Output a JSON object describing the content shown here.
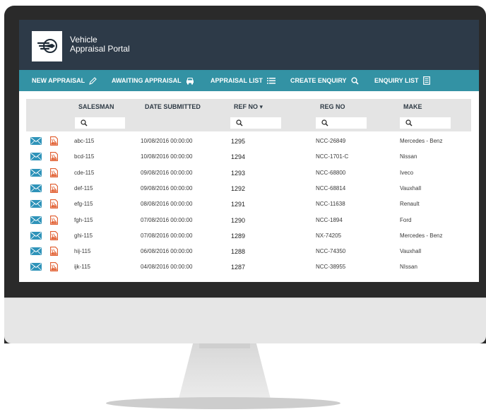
{
  "app": {
    "title_line1": "Vehicle",
    "title_line2": "Appraisal Portal"
  },
  "nav": [
    {
      "label": "NEW APPRAISAL",
      "icon": "pencil-icon"
    },
    {
      "label": "AWAITING APPRAISAL",
      "icon": "car-icon"
    },
    {
      "label": "APPRAISAL LIST",
      "icon": "list-icon"
    },
    {
      "label": "CREATE ENQUIRY",
      "icon": "search-icon"
    },
    {
      "label": "ENQUIRY LIST",
      "icon": "document-icon"
    }
  ],
  "table": {
    "columns": [
      "SALESMAN",
      "DATE SUBMITTED",
      "REF NO ▾",
      "REG NO",
      "MAKE"
    ],
    "rows": [
      {
        "salesman": "abc-115",
        "date": "10/08/2016 00:00:00",
        "ref": "1295",
        "reg": "NCC-26849",
        "make": "Mercedes - Benz"
      },
      {
        "salesman": "bcd-115",
        "date": "10/08/2016 00:00:00",
        "ref": "1294",
        "reg": "NCC-1701-C",
        "make": "Nissan"
      },
      {
        "salesman": "cde-115",
        "date": "09/08/2016 00:00:00",
        "ref": "1293",
        "reg": "NCC-68800",
        "make": "Iveco"
      },
      {
        "salesman": "def-115",
        "date": "09/08/2016 00:00:00",
        "ref": "1292",
        "reg": "NCC-68814",
        "make": "Vauxhall"
      },
      {
        "salesman": "efg-115",
        "date": "08/08/2016 00:00:00",
        "ref": "1291",
        "reg": "NCC-11638",
        "make": "Renault"
      },
      {
        "salesman": "fgh-115",
        "date": "07/08/2016 00:00:00",
        "ref": "1290",
        "reg": "NCC-1894",
        "make": "Ford"
      },
      {
        "salesman": "ghi-115",
        "date": "07/08/2016 00:00:00",
        "ref": "1289",
        "reg": "NX-74205",
        "make": "Mercedes - Benz"
      },
      {
        "salesman": "hij-115",
        "date": "06/08/2016 00:00:00",
        "ref": "1288",
        "reg": "NCC-74350",
        "make": "Vauxhall"
      },
      {
        "salesman": "ijk-115",
        "date": "04/08/2016 00:00:00",
        "ref": "1287",
        "reg": "NCC-38955",
        "make": "NIssan"
      }
    ]
  },
  "colors": {
    "header_bg": "#2d3a48",
    "nav_bg": "#3392a4",
    "mail_icon": "#2e93b9",
    "pdf_icon": "#e05a2b"
  }
}
